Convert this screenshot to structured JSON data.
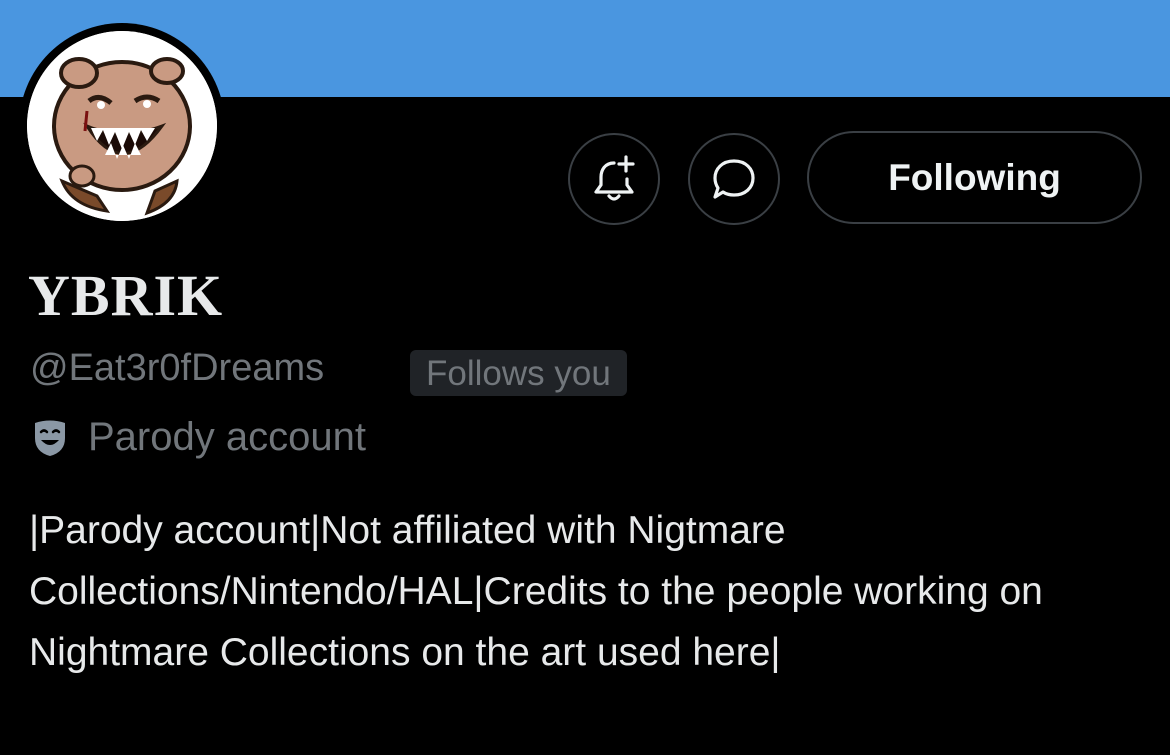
{
  "profile": {
    "display_name": "YBRIK",
    "handle": "@Eat3r0fDreams",
    "follows_you_badge": "Follows you",
    "account_label": "Parody account",
    "bio": "|Parody account|Not affiliated with Nigtmare Collections/Nintendo/HAL|Credits to the people working on Nightmare Collections on the art used here|"
  },
  "actions": {
    "notify_icon": "bell-plus-icon",
    "message_icon": "message-bubble-icon",
    "following_label": "Following"
  },
  "colors": {
    "banner": "#4a96e0",
    "background": "#000000",
    "text_primary": "#e7e9ea",
    "text_secondary": "#71767b",
    "badge_background": "#202327",
    "button_border": "#3a3f44"
  },
  "icons": {
    "parody": "theater-mask-icon"
  }
}
